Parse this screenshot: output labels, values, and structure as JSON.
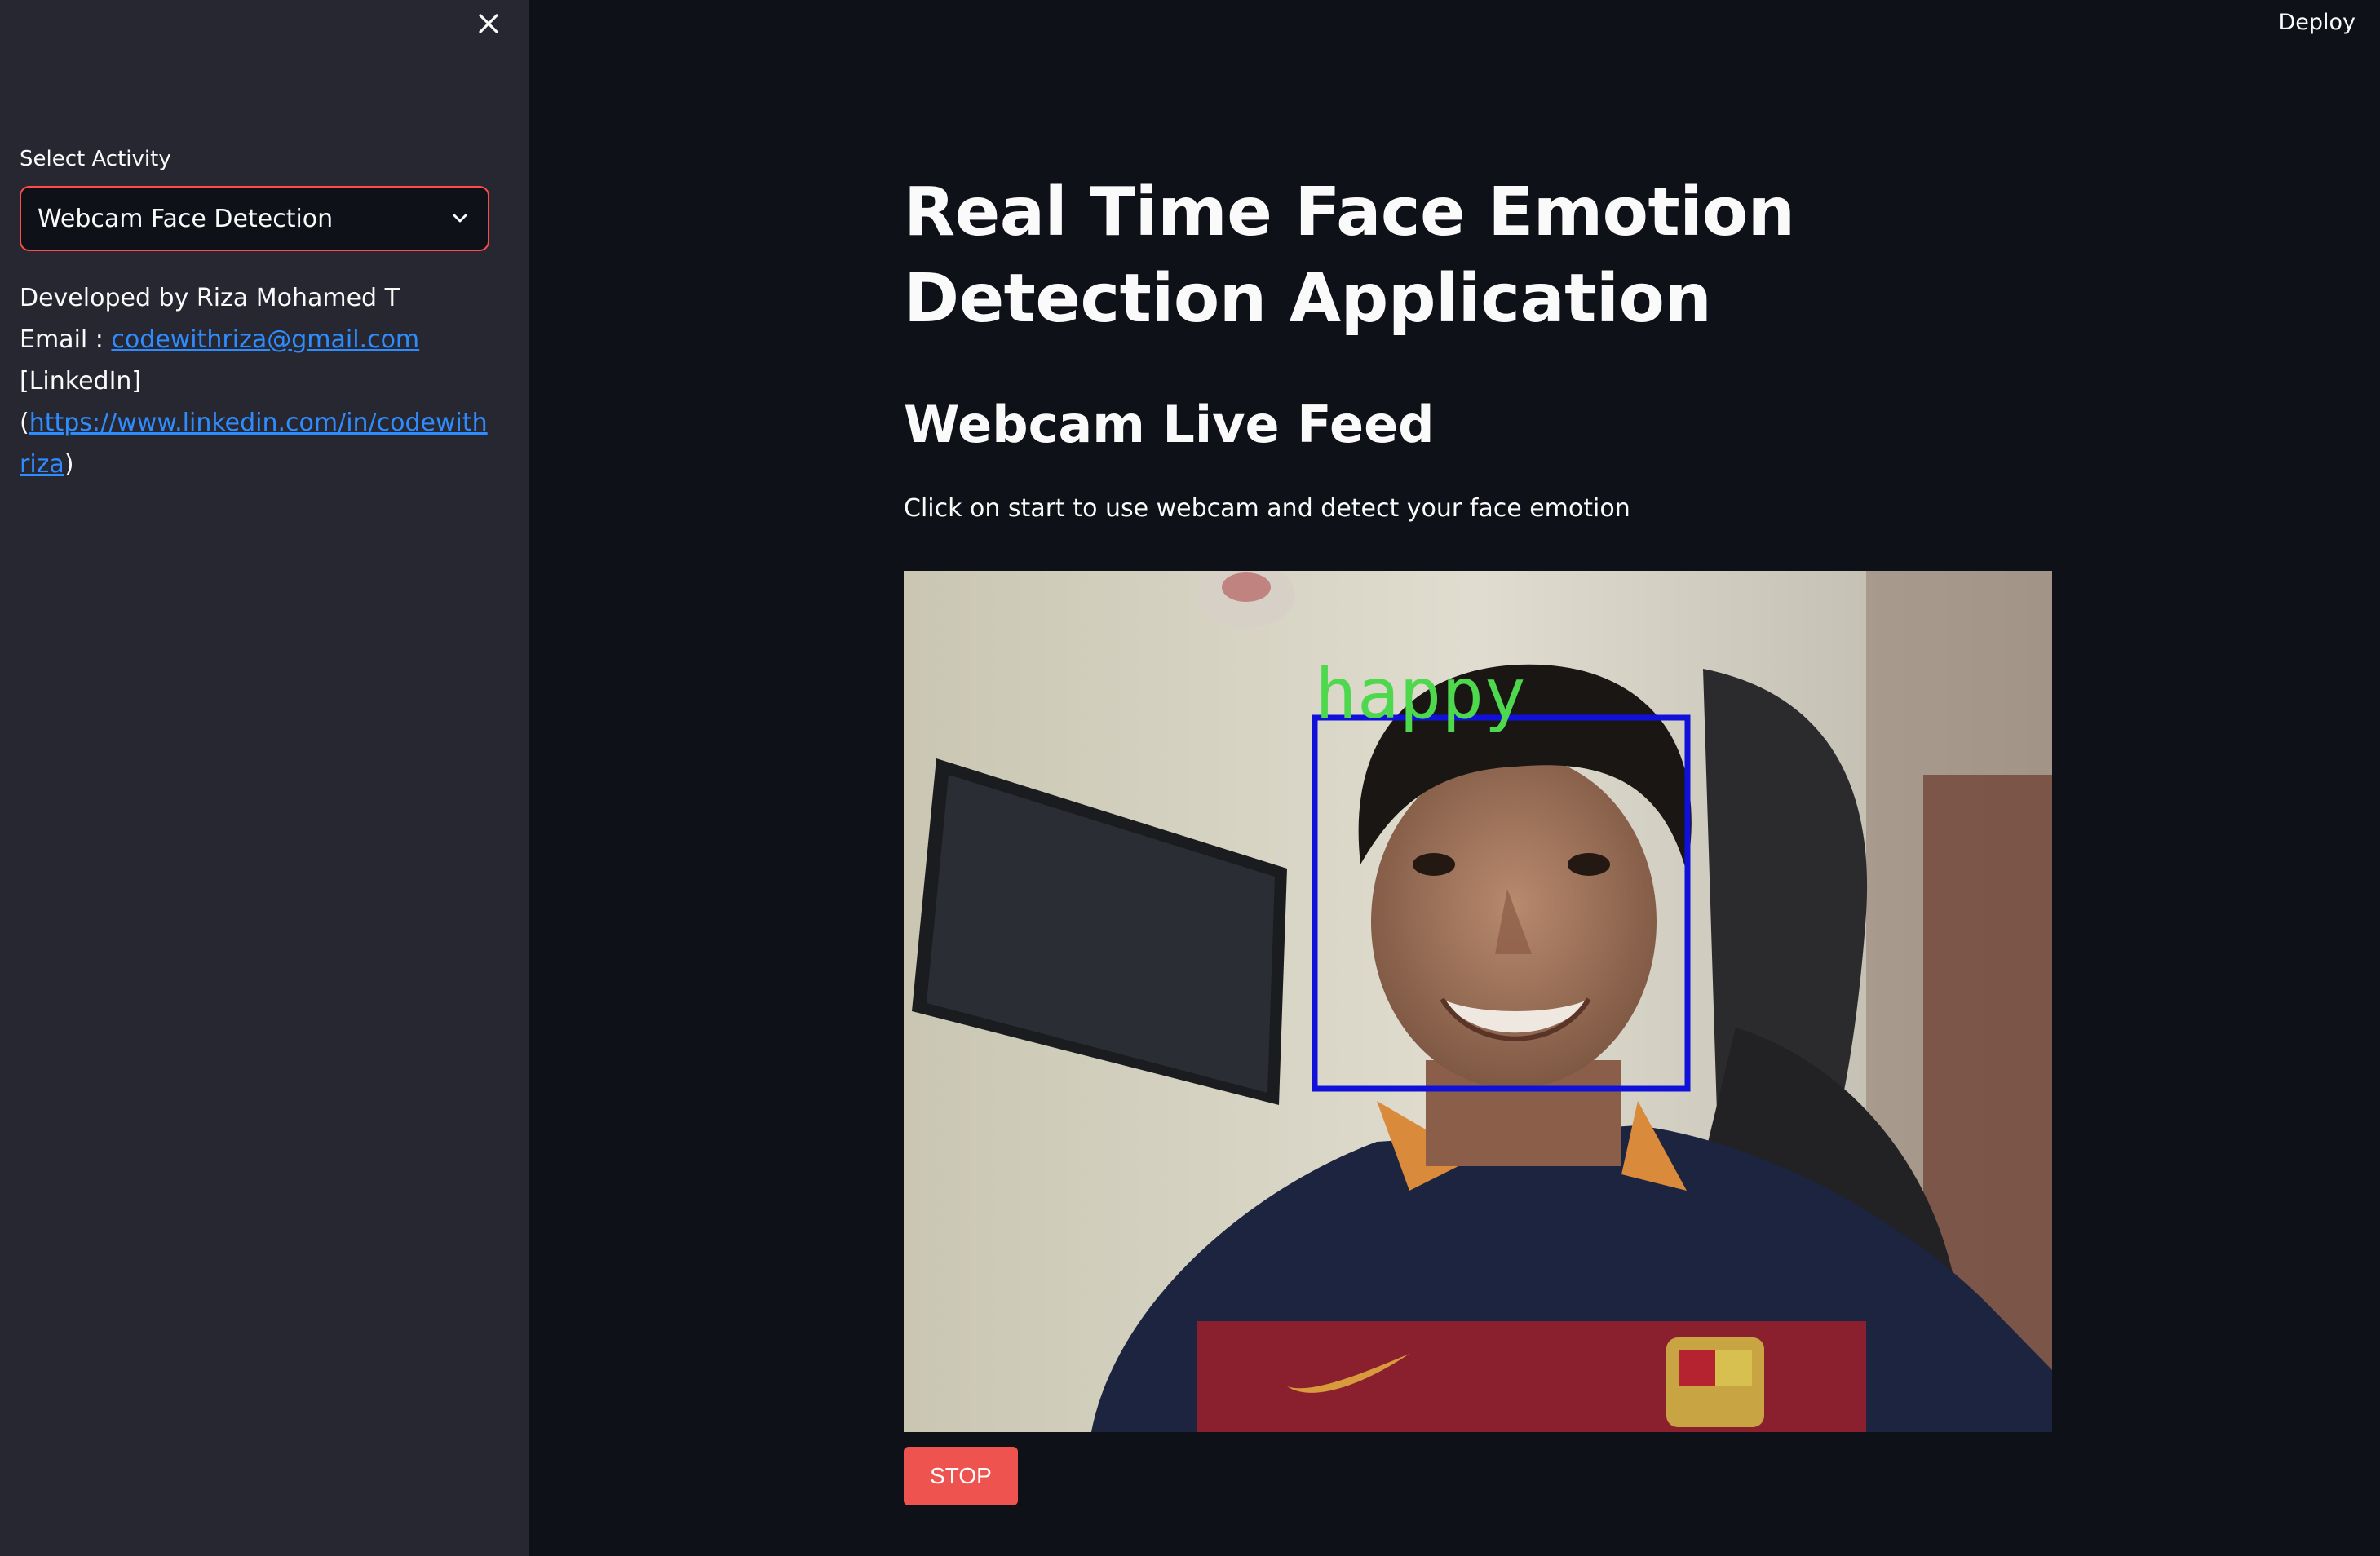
{
  "header": {
    "deploy_label": "Deploy"
  },
  "sidebar": {
    "select_label": "Select Activity",
    "select_value": "Webcam Face Detection",
    "developer_line": "Developed by Riza Mohamed T",
    "email_prefix": "Email : ",
    "email_link": "codewithriza@gmail.com",
    "linkedin_text": "[LinkedIn]",
    "linkedin_open": "(",
    "linkedin_url": "https://www.linkedin.com/in/codewithriza",
    "linkedin_close": ")"
  },
  "main": {
    "title": "Real Time Face Emotion Detection Application",
    "subtitle": "Webcam Live Feed",
    "description": "Click on start to use webcam and detect your face emotion",
    "video_label": "happy",
    "stop_label": "STOP"
  },
  "colors": {
    "sidebar_bg": "#262730",
    "main_bg": "#0e1117",
    "accent": "#ff4b4b",
    "link": "#2f8cff",
    "stop_button": "#ef5350",
    "detect_box": "#1010d8",
    "detect_label": "#4ed84e"
  },
  "icons": {
    "close": "close-icon",
    "dropdown": "chevron-down-icon"
  }
}
